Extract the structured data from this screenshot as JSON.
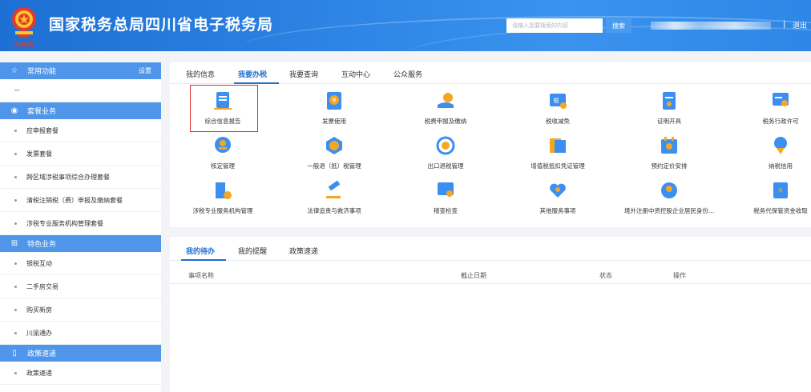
{
  "header": {
    "title": "国家税务总局四川省电子税务局",
    "emblem_text": "中国税务",
    "search_placeholder": "请输入您要搜索的内容",
    "search_label": "搜索",
    "separator": "|",
    "logout_label": "退出"
  },
  "sidebar": {
    "common": {
      "label": "常用功能",
      "settings": "设置",
      "placeholder": "--"
    },
    "sections": [
      {
        "title": "套餐业务",
        "icon": "package-icon",
        "items": [
          "应申报套餐",
          "发票套餐",
          "跨区域涉税事项综合办理套餐",
          "清税注销税（费）申报及缴纳套餐",
          "涉税专业服务机构管理套餐"
        ]
      },
      {
        "title": "特色业务",
        "icon": "grid-icon",
        "items": [
          "银税互动",
          "二手房交易",
          "购买新房",
          "川渝通办"
        ]
      },
      {
        "title": "政策速递",
        "icon": "phone-icon",
        "items": [
          "政策速递"
        ]
      }
    ]
  },
  "main": {
    "tabs": [
      "我的信息",
      "我要办税",
      "我要查询",
      "互动中心",
      "公众服务"
    ],
    "active_tab": "我要办税",
    "services": [
      {
        "label": "综合信息报告",
        "icon": "report-icon"
      },
      {
        "label": "发票使用",
        "icon": "invoice-icon"
      },
      {
        "label": "税费申报及缴纳",
        "icon": "tax-payment-icon"
      },
      {
        "label": "税收减免",
        "icon": "tax-reduction-icon"
      },
      {
        "label": "证明开具",
        "icon": "certificate-icon"
      },
      {
        "label": "税务行政许可",
        "icon": "permit-icon"
      },
      {
        "label": "核定管理",
        "icon": "verification-icon"
      },
      {
        "label": "一般退（抵）税管理",
        "icon": "refund-icon"
      },
      {
        "label": "出口退税管理",
        "icon": "export-refund-icon"
      },
      {
        "label": "增值税抵扣凭证管理",
        "icon": "voucher-icon"
      },
      {
        "label": "预约定价安排",
        "icon": "pricing-icon"
      },
      {
        "label": "纳税信用",
        "icon": "credit-icon"
      },
      {
        "label": "涉税专业服务机构管理",
        "icon": "agency-icon"
      },
      {
        "label": "法律追责与救济事项",
        "icon": "gavel-icon"
      },
      {
        "label": "稽查检查",
        "icon": "inspection-icon"
      },
      {
        "label": "其他服务事项",
        "icon": "heart-hands-icon"
      },
      {
        "label": "境外注册中资控股企业居民身份...",
        "icon": "overseas-icon"
      },
      {
        "label": "税务代保管资金收取",
        "icon": "custody-icon"
      }
    ],
    "colors": {
      "primary": "#1f6fd1",
      "icon_blue": "#3b8ff0",
      "icon_orange": "#f5a623",
      "highlight": "#e03030"
    }
  },
  "todo": {
    "tabs": [
      "我的待办",
      "我的提醒",
      "政策速递"
    ],
    "active_tab": "我的待办",
    "columns": [
      "事项名称",
      "截止日期",
      "状态",
      "操作"
    ]
  }
}
